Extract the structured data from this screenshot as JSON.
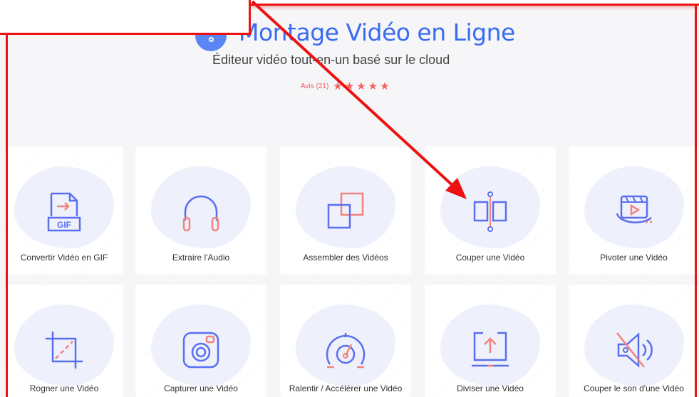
{
  "header": {
    "title": "Montage Vidéo en Ligne",
    "subtitle": "Éditeur vidéo tout-en-un basé sur le cloud",
    "rating_label": "Avis (21)",
    "stars": 5
  },
  "tools_row1": [
    {
      "label": "Convertir Vidéo en GIF",
      "icon": "gif-convert-icon"
    },
    {
      "label": "Extraire l'Audio",
      "icon": "headphones-icon"
    },
    {
      "label": "Assembler des Vidéos",
      "icon": "merge-icon"
    },
    {
      "label": "Couper une Vidéo",
      "icon": "cut-video-icon"
    },
    {
      "label": "Pivoter une Vidéo",
      "icon": "rotate-video-icon"
    }
  ],
  "tools_row2": [
    {
      "label": "Rogner une Vidéo",
      "icon": "crop-icon"
    },
    {
      "label": "Capturer une Vidéo",
      "icon": "camera-icon"
    },
    {
      "label": "Ralentir / Accélérer une Vidéo",
      "icon": "speed-dial-icon"
    },
    {
      "label": "Diviser une Vidéo",
      "icon": "split-upload-icon"
    },
    {
      "label": "Couper le son d'une Vidéo",
      "icon": "mute-icon"
    }
  ],
  "colors": {
    "accent_blue": "#3a6cf2",
    "icon_coral": "#f2837e",
    "annotation_red": "#e11111"
  }
}
